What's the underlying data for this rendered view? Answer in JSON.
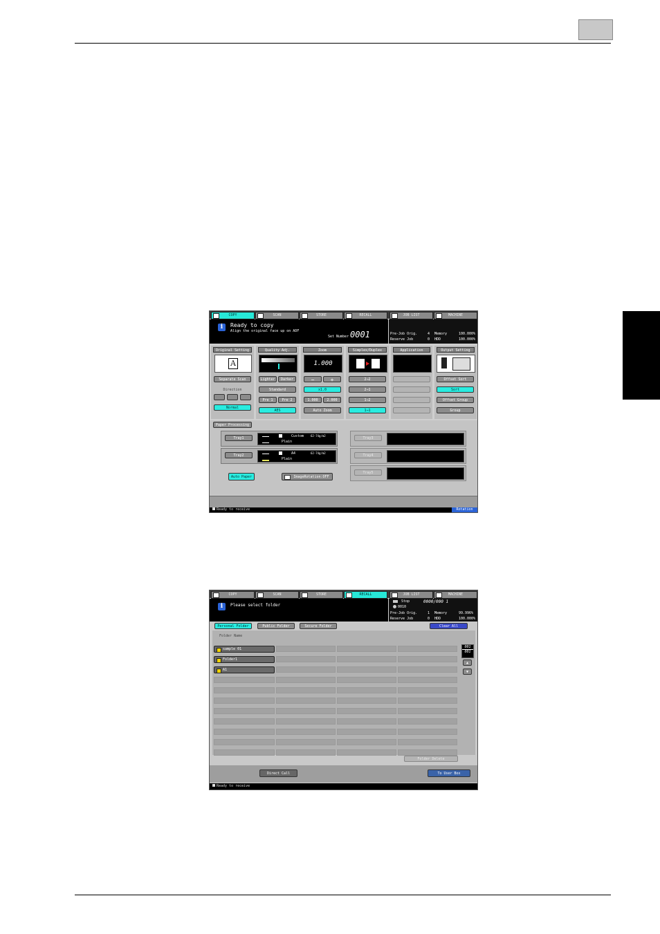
{
  "screen1": {
    "tabs": [
      "COPY",
      "SCAN",
      "STORE",
      "RECALL",
      "JOB LIST",
      "MACHINE"
    ],
    "message": {
      "title": "Ready to copy",
      "subtitle": "Align the original face up on ADF"
    },
    "set_number_label": "Set Number",
    "set_number": "0001",
    "stats": [
      {
        "label": "Pre-Job Orig.",
        "value": "4",
        "label2": "Memory",
        "value2": "100.000%"
      },
      {
        "label": "Reserve Job",
        "value": "0",
        "label2": "HDD",
        "value2": "100.000%"
      }
    ],
    "groups": {
      "original": {
        "header": "Original Setting",
        "separate_scan": "Separate Scan",
        "direction": "Direction",
        "normal": "Normal"
      },
      "quality": {
        "header": "Quality Adj.",
        "lighter": "Lighter",
        "darker": "Darker",
        "standard": "Standard",
        "pre1": "Pre 1",
        "pre2": "Pre 2",
        "aes": "AES"
      },
      "zoom": {
        "header": "Zoom",
        "value": "1.000",
        "minus": "−",
        "plus": "+",
        "x1": "x1.0",
        "btn_a": "1.000",
        "btn_b": "2.000",
        "auto_zoom": "Auto Zoom"
      },
      "simplex": {
        "header": "Simplex/Duplex",
        "b1": "2→2",
        "b2": "2→1",
        "b3": "1→2",
        "b4": "1→1"
      },
      "application": {
        "header": "Application"
      },
      "output": {
        "header": "Output Setting",
        "offset_sort": "Offset Sort",
        "sort": "Sort",
        "offset_group": "Offset Group",
        "group": "Group"
      }
    },
    "paper": {
      "header": "Paper Processing",
      "tray1": {
        "label": "Tray1",
        "size": "Custom",
        "weight": "62-74g/m2",
        "type": "Plain"
      },
      "tray2": {
        "label": "Tray2",
        "size": "A4",
        "weight": "62-74g/m2",
        "type": "Plain"
      },
      "tray3": "Tray3",
      "tray4": "Tray4",
      "tray5": "Tray5",
      "auto_paper": "Auto Paper",
      "image_rotation": "ImageRotation:OFF"
    },
    "status": "Ready to receive",
    "rotation": "Rotation"
  },
  "screen2": {
    "tabs": [
      "COPY",
      "SCAN",
      "STORE",
      "RECALL",
      "JOB LIST",
      "MACHINE"
    ],
    "message": "Please select folder",
    "stop": "Stop",
    "count": "0000/000 1",
    "user": "0010",
    "stats": [
      {
        "label": "Pre-Job Orig.",
        "value": "1",
        "label2": "Memory",
        "value2": "99.996%"
      },
      {
        "label": "Reserve Job",
        "value": "0",
        "label2": "HDD",
        "value2": "100.000%"
      }
    ],
    "folder_tabs": [
      "Personal Folder",
      "Public Folder",
      "Secure Folder"
    ],
    "clear_all": "Clear All",
    "folder_name": "Folder Name",
    "folders": [
      "sample 01",
      "Folder1",
      "A1"
    ],
    "page_top": "001",
    "page_bottom": "001",
    "folder_delete": "Folder Delete",
    "direct_call": "Direct Call",
    "to_user_box": "To User Box",
    "status": "Ready to receive"
  }
}
